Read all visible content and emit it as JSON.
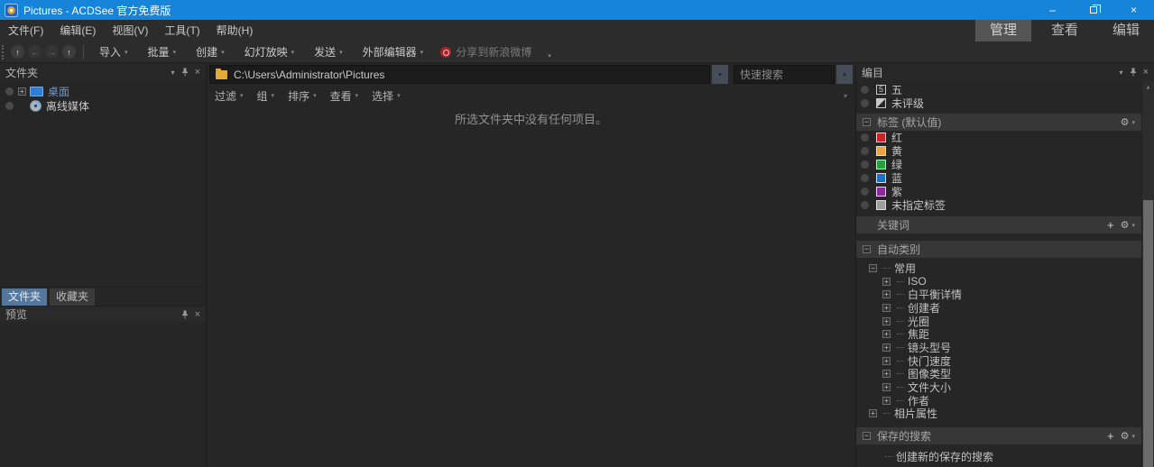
{
  "window": {
    "title": "Pictures - ACDSee 官方免费版"
  },
  "colors": {
    "titlebar": "#1684d9",
    "active_left_tab": "#54779e",
    "mode_tab_active": "#545454"
  },
  "icons": {
    "caret": "▾",
    "close": "×",
    "minimize": "–",
    "gear": "⚙",
    "plus": "+",
    "minus": "−",
    "up_arrow": "↑",
    "left_arrow": "←",
    "right_arrow": "→",
    "scroll_up": "▲",
    "overflow": "▾"
  },
  "menu": {
    "items": [
      "文件(F)",
      "编辑(E)",
      "视图(V)",
      "工具(T)",
      "帮助(H)"
    ]
  },
  "mode_tabs": {
    "items": [
      "管理",
      "查看",
      "编辑"
    ],
    "active": "管理"
  },
  "toolbar": {
    "buttons": [
      "导入",
      "批量",
      "创建",
      "幻灯放映",
      "发送",
      "外部编辑器"
    ],
    "share_label": "分享到新浪微博"
  },
  "folders_panel": {
    "title": "文件夹",
    "items": [
      {
        "label": "桌面"
      },
      {
        "label": "离线媒体"
      }
    ]
  },
  "left_tabs": {
    "items": [
      "文件夹",
      "收藏夹"
    ],
    "active": "文件夹"
  },
  "preview_panel": {
    "title": "预览"
  },
  "path_bar": {
    "path": "C:\\Users\\Administrator\\Pictures",
    "search_placeholder": "快速搜索"
  },
  "filter_bar": {
    "items": [
      "过滤",
      "组",
      "排序",
      "查看",
      "选择"
    ]
  },
  "content": {
    "empty_message": "所选文件夹中没有任何项目。"
  },
  "catalog_panel": {
    "title": "编目",
    "ratings": [
      {
        "icon": "5",
        "label": "五"
      },
      {
        "label": "未评级"
      }
    ],
    "tag_section_title": "标签 (默认值)",
    "tags": [
      {
        "label": "红",
        "color": "#cb2229"
      },
      {
        "label": "黄",
        "color": "#eca43c"
      },
      {
        "label": "绿",
        "color": "#22a13c"
      },
      {
        "label": "蓝",
        "color": "#1c70c3"
      },
      {
        "label": "紫",
        "color": "#8d2b9e"
      },
      {
        "label": "未指定标签",
        "color": "#9d9d9d"
      }
    ],
    "keywords_section_title": "关键词",
    "auto_section_title": "自动类别",
    "auto_root": "常用",
    "auto_children": [
      "ISO",
      "白平衡详情",
      "创建者",
      "光圈",
      "焦距",
      "镜头型号",
      "快门速度",
      "图像类型",
      "文件大小",
      "作者"
    ],
    "photo_props": "相片属性",
    "saved_section_title": "保存的搜索",
    "saved_new": "创建新的保存的搜索"
  }
}
